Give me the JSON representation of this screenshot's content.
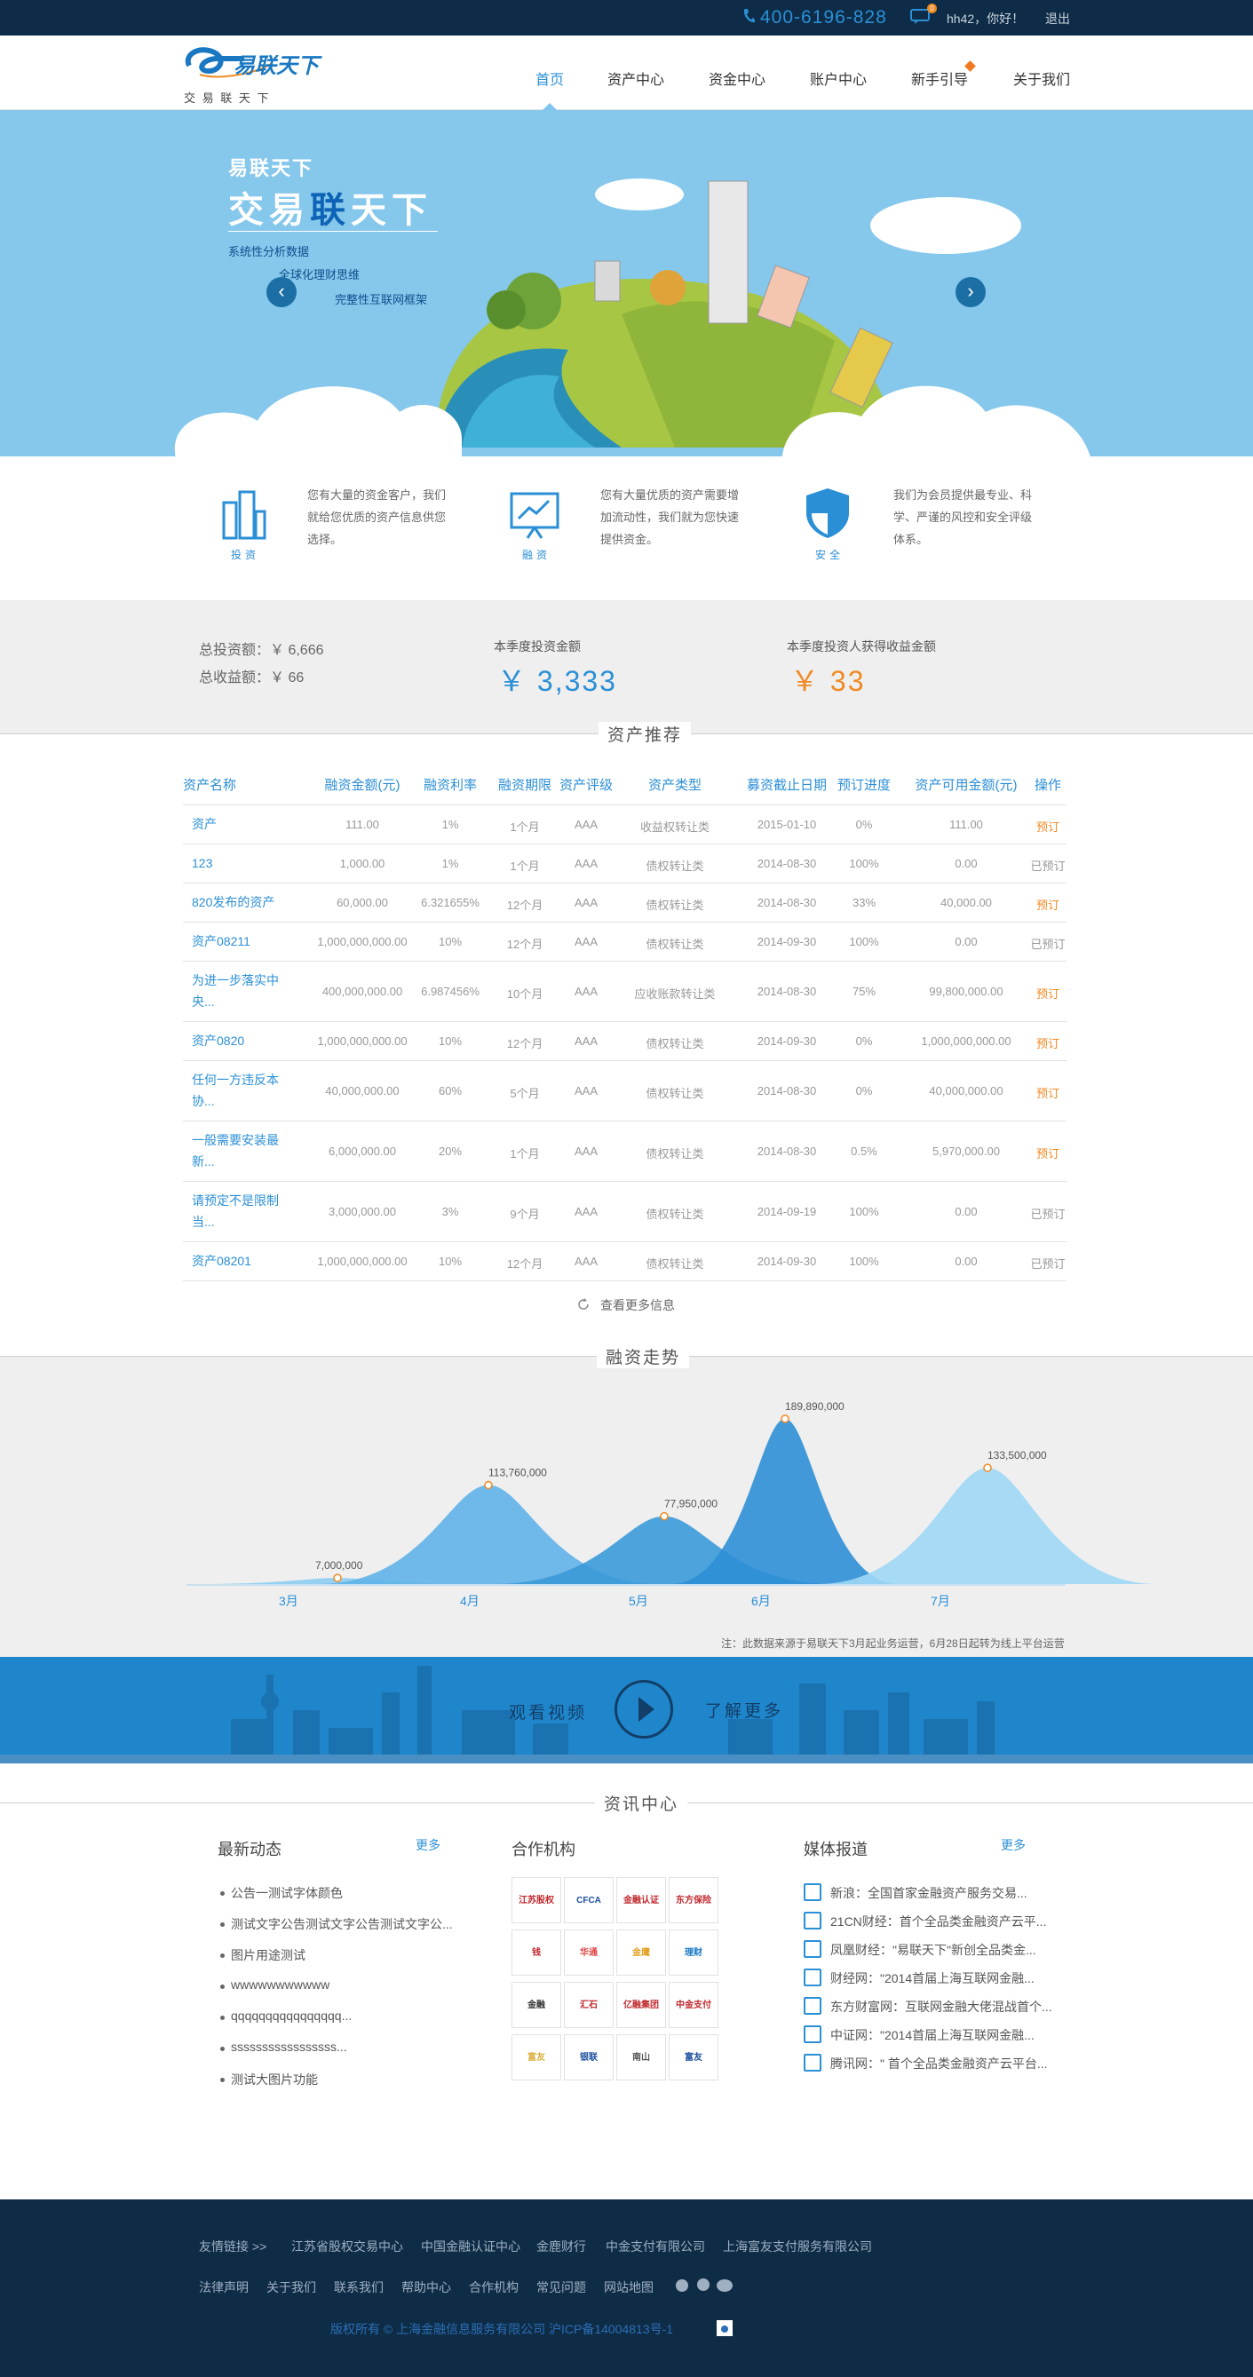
{
  "topbar": {
    "phone": "400-6196-828",
    "msg_count": "0",
    "greeting": "hh42，你好！",
    "logout": "退出"
  },
  "logo": {
    "main": "易联天下",
    "sub": "交 易 联 天 下"
  },
  "nav": [
    "首页",
    "资产中心",
    "资金中心",
    "账户中心",
    "新手引导",
    "关于我们"
  ],
  "banner": {
    "title_small": "易联天下",
    "title_big_a": "交易",
    "title_big_b": "联",
    "title_big_c": "天下",
    "s1": "系统性分析数据",
    "s2": "全球化理财思维",
    "s3": "完整性互联网框架"
  },
  "features": [
    {
      "label": "投资",
      "text": "您有大量的资金客户，我们就给您优质的资产信息供您选择。"
    },
    {
      "label": "融资",
      "text": "您有大量优质的资产需要增加流动性，我们就为您快速提供资金。"
    },
    {
      "label": "安全",
      "text": "我们为会员提供最专业、科学、严谨的风控和安全评级体系。"
    }
  ],
  "stats": {
    "total_invest": "总投资额：￥ 6,666",
    "total_income": "总收益额：￥ 66",
    "q_invest_label": "本季度投资金额",
    "q_invest": "￥ 3,333",
    "q_income_label": "本季度投资人获得收益金额",
    "q_income": "￥ 33"
  },
  "assets": {
    "title": "资产推荐",
    "headers": [
      "资产名称",
      "融资金额(元)",
      "融资利率",
      "融资期限",
      "资产评级",
      "资产类型",
      "募资截止日期",
      "预订进度",
      "资产可用金额(元)",
      "操作"
    ],
    "rows": [
      [
        "资产",
        "111.00",
        "1%",
        "1个月",
        "AAA",
        "收益权转让类",
        "2015-01-10",
        "0%",
        "111.00",
        "预订"
      ],
      [
        "123",
        "1,000.00",
        "1%",
        "1个月",
        "AAA",
        "债权转让类",
        "2014-08-30",
        "100%",
        "0.00",
        "已预订"
      ],
      [
        "820发布的资产",
        "60,000.00",
        "6.321655%",
        "12个月",
        "AAA",
        "债权转让类",
        "2014-08-30",
        "33%",
        "40,000.00",
        "预订"
      ],
      [
        "资产08211",
        "1,000,000,000.00",
        "10%",
        "12个月",
        "AAA",
        "债权转让类",
        "2014-09-30",
        "100%",
        "0.00",
        "已预订"
      ],
      [
        "为进一步落实中央...",
        "400,000,000.00",
        "6.987456%",
        "10个月",
        "AAA",
        "应收账款转让类",
        "2014-08-30",
        "75%",
        "99,800,000.00",
        "预订"
      ],
      [
        "资产0820",
        "1,000,000,000.00",
        "10%",
        "12个月",
        "AAA",
        "债权转让类",
        "2014-09-30",
        "0%",
        "1,000,000,000.00",
        "预订"
      ],
      [
        "任何一方违反本协...",
        "40,000,000.00",
        "60%",
        "5个月",
        "AAA",
        "债权转让类",
        "2014-08-30",
        "0%",
        "40,000,000.00",
        "预订"
      ],
      [
        "一般需要安装最新...",
        "6,000,000.00",
        "20%",
        "1个月",
        "AAA",
        "债权转让类",
        "2014-08-30",
        "0.5%",
        "5,970,000.00",
        "预订"
      ],
      [
        "请预定不是限制当...",
        "3,000,000.00",
        "3%",
        "9个月",
        "AAA",
        "债权转让类",
        "2014-09-19",
        "100%",
        "0.00",
        "已预订"
      ],
      [
        "资产08201",
        "1,000,000,000.00",
        "10%",
        "12个月",
        "AAA",
        "债权转让类",
        "2014-09-30",
        "100%",
        "0.00",
        "已预订"
      ]
    ],
    "more": "查看更多信息"
  },
  "chart_data": {
    "type": "area",
    "title": "融资走势",
    "categories": [
      "3月",
      "4月",
      "5月",
      "6月",
      "7月"
    ],
    "points": [
      {
        "month": "3月",
        "label": "7,000,000",
        "value": 7000000
      },
      {
        "month": "4月",
        "label": "113,760,000",
        "value": 113760000
      },
      {
        "month": "5月",
        "label": "77,950,000",
        "value": 77950000
      },
      {
        "month": "6月",
        "label": "189,890,000",
        "value": 189890000
      },
      {
        "month": "7月",
        "label": "133,500,000",
        "value": 133500000
      }
    ],
    "note": "注：此数据来源于易联天下3月起业务运营，6月28日起转为线上平台运营"
  },
  "video": {
    "watch": "观看视频",
    "learn": "了解更多"
  },
  "news": {
    "title": "资讯中心",
    "latest": {
      "title": "最新动态",
      "more": "更多",
      "items": [
        "公告一测试字体颜色",
        "测试文字公告测试文字公告测试文字公...",
        "图片用途测试",
        "wwwwwwwwwww",
        "qqqqqqqqqqqqqqqq...",
        "sssssssssssssssss...",
        "测试大图片功能"
      ]
    },
    "partners": {
      "title": "合作机构",
      "items": [
        "江苏股权",
        "CFCA",
        "金融认证",
        "东方保险",
        "钱",
        "华通",
        "金鹰",
        "理财",
        "金融",
        "汇石",
        "亿融集团",
        "中金支付",
        "富友",
        "银联",
        "南山",
        "富友"
      ]
    },
    "media": {
      "title": "媒体报道",
      "more": "更多",
      "items": [
        "新浪：全国首家金融资产服务交易...",
        "21CN财经：首个全品类金融资产云平...",
        "凤凰财经：\"易联天下\"新创全品类金...",
        "财经网：\"2014首届上海互联网金融...",
        "东方财富网：互联网金融大佬混战首个...",
        "中证网：\"2014首届上海互联网金融...",
        "腾讯网：\" 首个全品类金融资产云平台..."
      ]
    }
  },
  "footer": {
    "links1": [
      "友情链接 >>",
      "江苏省股权交易中心",
      "中国金融认证中心",
      "金鹿财行",
      "中金支付有限公司",
      "上海富友支付服务有限公司"
    ],
    "links2": [
      "法律声明",
      "关于我们",
      "联系我们",
      "帮助中心",
      "合作机构",
      "常见问题",
      "网站地图"
    ],
    "copyright": "版权所有 © 上海金融信息服务有限公司 沪ICP备14004813号-1"
  }
}
